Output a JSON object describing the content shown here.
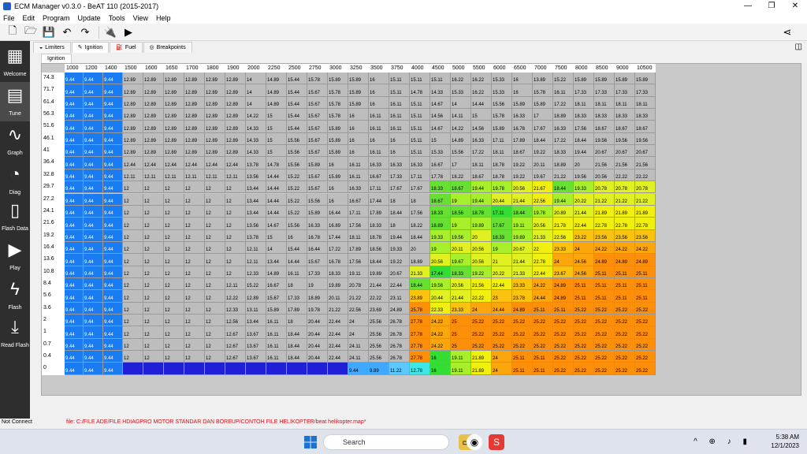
{
  "window": {
    "title": "ECM Manager v0.3.0 - BeAT 110  (2015-2017)",
    "min": "—",
    "max": "❐",
    "close": "✕"
  },
  "menu": [
    "File",
    "Edit",
    "Program",
    "Update",
    "Tools",
    "View",
    "Help"
  ],
  "sidebar": [
    {
      "label": "Welcome",
      "icon": "grid-tiles-icon"
    },
    {
      "label": "Tune",
      "icon": "table-icon",
      "active": true
    },
    {
      "label": "Graph",
      "icon": "graph-icon"
    },
    {
      "label": "Diag",
      "icon": "gauge-icon"
    },
    {
      "label": "Flash Data",
      "icon": "chip-icon"
    },
    {
      "label": "Play",
      "icon": "play-icon"
    },
    {
      "label": "Flash",
      "icon": "lightning-icon"
    },
    {
      "label": "Read Flash",
      "icon": "download-icon"
    }
  ],
  "tabs": [
    {
      "label": "Limiters",
      "icon": "speedometer-icon"
    },
    {
      "label": "Ignition",
      "icon": "spark-plug-icon",
      "selected": true
    },
    {
      "label": "Fuel",
      "icon": "fuel-icon"
    },
    {
      "label": "Breakpoints",
      "icon": "target-icon"
    }
  ],
  "subtab": "Ignition",
  "table": {
    "cols": [
      "1000",
      "1200",
      "1400",
      "1500",
      "1600",
      "1650",
      "1700",
      "1800",
      "1900",
      "2000",
      "2250",
      "2500",
      "2750",
      "3000",
      "3250",
      "3500",
      "3750",
      "4000",
      "4500",
      "5000",
      "5500",
      "6000",
      "6500",
      "7000",
      "7500",
      "8000",
      "8500",
      "9000",
      "10500"
    ],
    "rows": [
      "74.3",
      "71.7",
      "61.4",
      "56.3",
      "51.6",
      "46.1",
      "41",
      "36.4",
      "32.8",
      "29.7",
      "27.2",
      "24.1",
      "21.6",
      "19.2",
      "16.4",
      "13.6",
      "10.8",
      "8.4",
      "5.6",
      "3.6",
      "2",
      "1",
      "0.7",
      "0.4",
      "0"
    ],
    "vals": [
      [
        "9.44",
        "9.44",
        "9.44",
        "12.89",
        "12.89",
        "12.89",
        "12.89",
        "12.89",
        "12.89",
        "14",
        "14.89",
        "15.44",
        "15.78",
        "15.89",
        "15.89",
        "16",
        "15.11",
        "15.11",
        "15.11",
        "16.22",
        "16.22",
        "15.33",
        "16",
        "13.89",
        "15.22",
        "15.89",
        "15.89"
      ],
      [
        "9.44",
        "9.44",
        "9.44",
        "12.89",
        "12.89",
        "12.89",
        "12.89",
        "12.89",
        "12.89",
        "14",
        "14.89",
        "15.44",
        "15.67",
        "15.78",
        "15.89",
        "16",
        "15.11",
        "14.78",
        "14.33",
        "15.33",
        "16.22",
        "15.33",
        "16",
        "15.78",
        "16.11",
        "17.33",
        "17.33"
      ],
      [
        "9.44",
        "9.44",
        "9.44",
        "12.89",
        "12.89",
        "12.89",
        "12.89",
        "12.89",
        "12.89",
        "14",
        "14.89",
        "15.44",
        "15.67",
        "15.78",
        "15.89",
        "16",
        "16.11",
        "15.11",
        "14.67",
        "14",
        "14.44",
        "15.56",
        "15.89",
        "15.89",
        "17.22",
        "18.11",
        "18.11"
      ],
      [
        "9.44",
        "9.44",
        "9.44",
        "12.89",
        "12.89",
        "12.89",
        "12.89",
        "12.89",
        "12.89",
        "14.22",
        "15",
        "15.44",
        "15.67",
        "15.78",
        "16",
        "16.11",
        "16.11",
        "15.11",
        "14.56",
        "14.11",
        "15",
        "15.78",
        "16.33",
        "17",
        "18.89",
        "18.33",
        "18.33"
      ],
      [
        "9.44",
        "9.44",
        "9.44",
        "12.89",
        "12.89",
        "12.89",
        "12.89",
        "12.89",
        "12.89",
        "14.33",
        "15",
        "15.44",
        "15.67",
        "15.89",
        "16",
        "16.11",
        "16.11",
        "15.11",
        "14.67",
        "14.22",
        "14.56",
        "15.89",
        "16.78",
        "17.67",
        "16.33",
        "17.56",
        "18.67",
        "18.67"
      ],
      [
        "9.44",
        "9.44",
        "9.44",
        "12.89",
        "12.89",
        "12.89",
        "12.89",
        "12.89",
        "12.89",
        "14.33",
        "15",
        "15.56",
        "15.67",
        "15.89",
        "16",
        "16",
        "16",
        "15.11",
        "15",
        "14.89",
        "16.33",
        "17.11",
        "17.89",
        "18.44",
        "17.22",
        "18.44",
        "19.56",
        "19.56"
      ],
      [
        "9.44",
        "9.44",
        "9.44",
        "12.89",
        "12.89",
        "12.89",
        "12.89",
        "12.89",
        "12.89",
        "14.33",
        "15",
        "15.56",
        "15.67",
        "15.89",
        "16",
        "16.11",
        "16",
        "15.11",
        "15.33",
        "15.56",
        "17.22",
        "18.11",
        "18.67",
        "19.22",
        "18.33",
        "19.44",
        "20.67",
        "20.67"
      ],
      [
        "9.44",
        "9.44",
        "9.44",
        "12.44",
        "12.44",
        "12.44",
        "12.44",
        "12.44",
        "12.44",
        "13.78",
        "14.78",
        "15.56",
        "15.89",
        "16",
        "16.11",
        "16.33",
        "16.33",
        "16.33",
        "16.67",
        "17",
        "18.11",
        "18.78",
        "19.22",
        "20.11",
        "18.89",
        "20",
        "21.56",
        "21.56"
      ],
      [
        "9.44",
        "9.44",
        "9.44",
        "12.11",
        "12.11",
        "12.11",
        "12.11",
        "12.11",
        "12.11",
        "13.56",
        "14.44",
        "15.22",
        "15.67",
        "15.89",
        "16.11",
        "16.67",
        "17.33",
        "17.11",
        "17.78",
        "18.22",
        "18.67",
        "18.78",
        "19.22",
        "19.67",
        "21.22",
        "19.56",
        "20.56",
        "22.22",
        "22.22"
      ],
      [
        "9.44",
        "9.44",
        "9.44",
        "12",
        "12",
        "12",
        "12",
        "12",
        "12",
        "13.44",
        "14.44",
        "15.22",
        "15.67",
        "16",
        "16.33",
        "17.11",
        "17.67",
        "17.67",
        "18.33",
        "18.67",
        "19.44",
        "19.78",
        "20.56",
        "21.67",
        "18.44",
        "19.33",
        "20.78",
        "20.78"
      ],
      [
        "9.44",
        "9.44",
        "9.44",
        "12",
        "12",
        "12",
        "12",
        "12",
        "12",
        "13.44",
        "14.44",
        "15.22",
        "15.56",
        "16",
        "16.67",
        "17.44",
        "18",
        "18",
        "18.67",
        "19",
        "19.44",
        "20.44",
        "21.44",
        "22.56",
        "19.44",
        "20.22",
        "21.22",
        "21.22"
      ],
      [
        "9.44",
        "9.44",
        "9.44",
        "12",
        "12",
        "12",
        "12",
        "12",
        "12",
        "13.44",
        "14.44",
        "15.22",
        "15.89",
        "16.44",
        "17.11",
        "17.89",
        "18.44",
        "17.56",
        "18.33",
        "18.56",
        "18.78",
        "17.11",
        "18.44",
        "19.78",
        "20.89",
        "21.44",
        "21.89",
        "21.89"
      ],
      [
        "9.44",
        "9.44",
        "9.44",
        "12",
        "12",
        "12",
        "12",
        "12",
        "12",
        "13.56",
        "14.67",
        "15.56",
        "16.33",
        "16.89",
        "17.56",
        "18.33",
        "18",
        "18.22",
        "18.89",
        "19",
        "19.89",
        "17.67",
        "19.11",
        "20.56",
        "21.78",
        "22.44",
        "22.78",
        "22.78"
      ],
      [
        "9.44",
        "9.44",
        "9.44",
        "12",
        "12",
        "12",
        "12",
        "12",
        "12",
        "13.78",
        "15",
        "16",
        "16.78",
        "17.44",
        "18.11",
        "18.78",
        "19.44",
        "18.44",
        "19.33",
        "19.56",
        "20",
        "18.33",
        "19.89",
        "21.33",
        "22.56",
        "23.22",
        "23.56",
        "23.56"
      ],
      [
        "9.44",
        "9.44",
        "9.44",
        "12",
        "12",
        "12",
        "12",
        "12",
        "12",
        "12.11",
        "14",
        "15.44",
        "16.44",
        "17.22",
        "17.89",
        "18.56",
        "19.33",
        "20",
        "19",
        "20.11",
        "20.56",
        "19",
        "20.67",
        "22",
        "23.33",
        "24",
        "24.22",
        "24.22"
      ],
      [
        "9.44",
        "9.44",
        "9.44",
        "12",
        "12",
        "12",
        "12",
        "12",
        "12",
        "12.11",
        "13.44",
        "14.44",
        "15.67",
        "16.78",
        "17.56",
        "18.44",
        "19.22",
        "18.89",
        "20.56",
        "19.67",
        "20.56",
        "21",
        "21.44",
        "22.78",
        "24",
        "24.56",
        "24.89",
        "24.89"
      ],
      [
        "9.44",
        "9.44",
        "9.44",
        "12",
        "12",
        "12",
        "12",
        "12",
        "12",
        "12.33",
        "14.89",
        "16.11",
        "17.33",
        "18.33",
        "19.11",
        "19.89",
        "20.67",
        "21.33",
        "17.44",
        "18.33",
        "19.22",
        "20.22",
        "21.33",
        "22.44",
        "23.67",
        "24.56",
        "25.11",
        "25.11"
      ],
      [
        "9.44",
        "9.44",
        "9.44",
        "12",
        "12",
        "12",
        "12",
        "12",
        "12.11",
        "15.22",
        "16.67",
        "18",
        "19",
        "19.89",
        "20.78",
        "21.44",
        "22.44",
        "18.44",
        "19.56",
        "20.56",
        "21.56",
        "22.44",
        "23.33",
        "24.22",
        "24.89",
        "25.11",
        "25.11",
        "25.11"
      ],
      [
        "9.44",
        "9.44",
        "9.44",
        "12",
        "12",
        "12",
        "12",
        "12",
        "12.22",
        "12.89",
        "15.67",
        "17.33",
        "18.89",
        "20.11",
        "21.22",
        "22.22",
        "23.11",
        "23.89",
        "20.44",
        "21.44",
        "22.22",
        "23",
        "23.78",
        "24.44",
        "24.89",
        "25.11",
        "25.11",
        "25.11"
      ],
      [
        "9.44",
        "9.44",
        "9.44",
        "12",
        "12",
        "12",
        "12",
        "12",
        "12.33",
        "13.11",
        "15.89",
        "17.89",
        "19.78",
        "21.22",
        "22.56",
        "23.69",
        "24.89",
        "25.78",
        "22.33",
        "23.33",
        "24",
        "24.44",
        "24.89",
        "25.11",
        "25.11",
        "25.22",
        "25.22",
        "25.22"
      ],
      [
        "9.44",
        "9.44",
        "9.44",
        "12",
        "12",
        "12",
        "12",
        "12",
        "12.56",
        "13.44",
        "16.11",
        "18",
        "20.44",
        "22.44",
        "24",
        "25.56",
        "26.78",
        "27.78",
        "24.22",
        "25",
        "25.22",
        "25.22",
        "25.22",
        "25.22",
        "25.22",
        "25.22",
        "25.22",
        "25.22"
      ],
      [
        "9.44",
        "9.44",
        "9.44",
        "12",
        "12",
        "12",
        "12",
        "12",
        "12.67",
        "13.67",
        "16.11",
        "18.44",
        "20.44",
        "22.44",
        "24",
        "25.56",
        "26.78",
        "27.78",
        "24.22",
        "25",
        "25.22",
        "25.22",
        "25.22",
        "25.22",
        "25.22",
        "25.22",
        "25.22",
        "25.22"
      ],
      [
        "9.44",
        "9.44",
        "9.44",
        "12",
        "12",
        "12",
        "12",
        "12",
        "12.67",
        "13.67",
        "16.11",
        "18.44",
        "20.44",
        "22.44",
        "24.11",
        "25.56",
        "26.78",
        "27.78",
        "24.22",
        "25",
        "25.22",
        "25.22",
        "25.22",
        "25.22",
        "25.22",
        "25.22",
        "25.22",
        "25.22"
      ],
      [
        "9.44",
        "9.44",
        "9.44",
        "12",
        "12",
        "12",
        "12",
        "12",
        "12.67",
        "13.67",
        "16.11",
        "18.44",
        "20.44",
        "22.44",
        "24.11",
        "25.56",
        "26.78",
        "27.78",
        "16",
        "19.11",
        "21.89",
        "24",
        "25.11",
        "25.11",
        "25.22",
        "25.22",
        "25.22",
        "25.22"
      ],
      [
        "9.44",
        "9.44",
        "9.44",
        "",
        "",
        "",
        "",
        "",
        "",
        "",
        "",
        "",
        "",
        "",
        "9.44",
        "9.89",
        "11.22",
        "12.78",
        "16",
        "19.11",
        "21.89",
        "24",
        "25.11",
        "25.11",
        "25.22",
        "25.22",
        "25.22",
        "25.22"
      ]
    ]
  },
  "status": {
    "left": "Not Connect",
    "file": "file: C:/FILE ADE/FILE HDIAGPRO MOTOR STANDAR DAN BOREUP/CONTOH FILE HELIKOPTER/beat helikopter.map*"
  },
  "taskbar": {
    "search": "Search",
    "time": "5:38 AM",
    "date": "12/1/2023"
  }
}
